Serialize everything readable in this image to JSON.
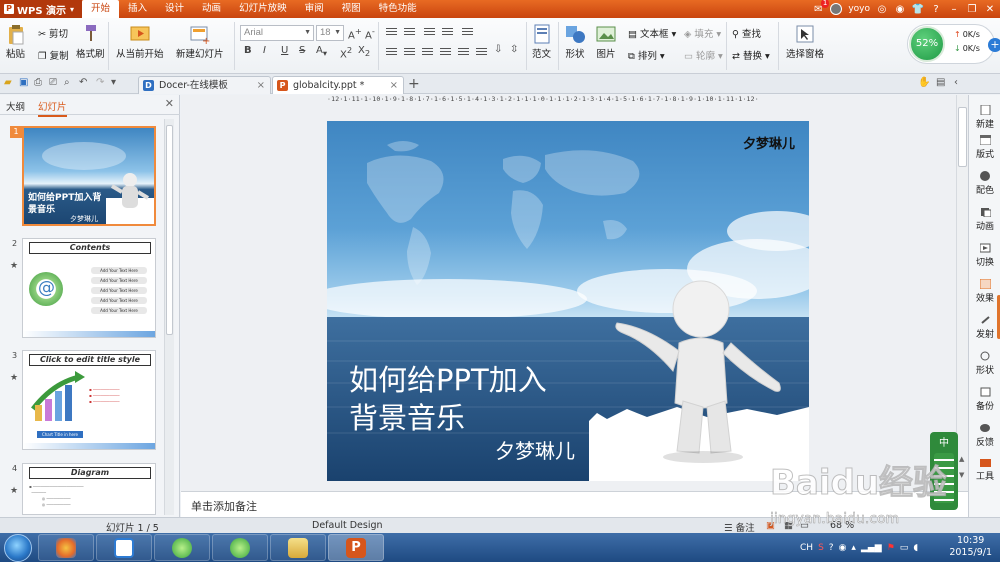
{
  "app": {
    "name": "WPS 演示",
    "menu_tabs": [
      "开始",
      "插入",
      "设计",
      "动画",
      "幻灯片放映",
      "审阅",
      "视图",
      "特色功能"
    ],
    "active_menu_tab": "开始",
    "user_name": "yoyo",
    "mail_count": "1"
  },
  "ribbon": {
    "paste": "粘贴",
    "cut": "剪切",
    "copy": "复制",
    "format_painter": "格式刷",
    "from_current": "从当前开始",
    "new_slide": "新建幻灯片",
    "font_name": "Arial",
    "font_size": "18",
    "template": "范文",
    "shape": "形状",
    "picture": "图片",
    "textbox": "文本框",
    "arrange": "排列",
    "fill": "填充",
    "outline": "轮廓",
    "find": "查找",
    "replace": "替换",
    "select_pane": "选择窗格",
    "speed_percent": "52%",
    "speed_up": "0K/s",
    "speed_down": "0K/s"
  },
  "doc_tabs": [
    {
      "label": "Docer-在线模板",
      "active": false
    },
    {
      "label": "globalcity.ppt *",
      "active": true
    }
  ],
  "left_panel": {
    "tab_outline": "大纲",
    "tab_slides": "幻灯片",
    "active_tab": "幻灯片",
    "thumbnails": [
      {
        "num": "1",
        "title": "如何给PPT加入背景音乐",
        "author": "夕梦琳儿"
      },
      {
        "num": "2",
        "title": "Contents",
        "items": [
          "Add Your Text Here",
          "Add Your Text Here",
          "Add Your Text Here",
          "Add Your Text Here",
          "Add Your Text Here"
        ]
      },
      {
        "num": "3",
        "title": "Click to edit title style",
        "bar_caption": "Chart Title in here"
      },
      {
        "num": "4",
        "title": "Diagram"
      }
    ]
  },
  "ruler_text": "·12·1·11·1·10·1·9·1·8·1·7·1·6·1·5·1·4·1·3·1·2·1·1·1·0·1·1·1·2·1·3·1·4·1·5·1·6·1·7·1·8·1·9·1·10·1·11·1·12·",
  "slide": {
    "author_top": "夕梦琳儿",
    "title_line1": "如何给PPT加入",
    "title_line2": "背景音乐",
    "author": "夕梦琳儿"
  },
  "notes_placeholder": "单击添加备注",
  "right_pane": [
    "新建",
    "版式",
    "配色",
    "动画",
    "切换",
    "效果",
    "发射",
    "形状",
    "备份",
    "反馈",
    "工具"
  ],
  "status": {
    "slide_counter": "幻灯片 1 / 5",
    "theme": "Default Design",
    "notes": "备注",
    "zoom": "68 %"
  },
  "taskbar": {
    "time": "10:39",
    "date": "2015/9/1",
    "lang": "CH"
  },
  "watermark": {
    "brand": "Baidu经验",
    "url": "jingyan.baidu.com"
  },
  "ime_label": "中"
}
